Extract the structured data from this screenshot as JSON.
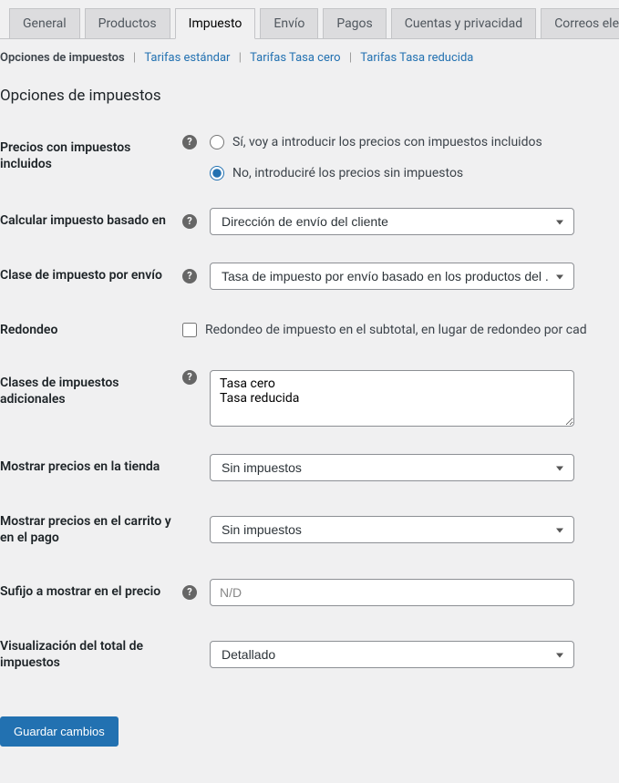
{
  "tabs": [
    {
      "label": "General",
      "active": false
    },
    {
      "label": "Productos",
      "active": false
    },
    {
      "label": "Impuesto",
      "active": true
    },
    {
      "label": "Envío",
      "active": false
    },
    {
      "label": "Pagos",
      "active": false
    },
    {
      "label": "Cuentas y privacidad",
      "active": false
    },
    {
      "label": "Correos electróni",
      "active": false
    }
  ],
  "subnav": {
    "items": [
      {
        "label": "Opciones de impuestos",
        "current": true
      },
      {
        "label": "Tarifas estándar",
        "current": false
      },
      {
        "label": "Tarifas Tasa cero",
        "current": false
      },
      {
        "label": "Tarifas Tasa reducida",
        "current": false
      }
    ]
  },
  "section_title": "Opciones de impuestos",
  "fields": {
    "prices_with_tax": {
      "label": "Precios con impuestos incluidos",
      "option_yes": "Sí, voy a introducir los precios con impuestos incluidos",
      "option_no": "No, introduciré los precios sin impuestos",
      "selected": "no"
    },
    "calc_based_on": {
      "label": "Calcular impuesto basado en",
      "value": "Dirección de envío del cliente"
    },
    "shipping_tax_class": {
      "label": "Clase de impuesto por envío",
      "value": "Tasa de impuesto por envío basado en los productos del ..."
    },
    "rounding": {
      "label": "Redondeo",
      "option": "Redondeo de impuesto en el subtotal, en lugar de redondeo por cad",
      "checked": false
    },
    "additional_classes": {
      "label": "Clases de impuestos adicionales",
      "value": "Tasa cero\nTasa reducida"
    },
    "display_shop": {
      "label": "Mostrar precios en la tienda",
      "value": "Sin impuestos"
    },
    "display_cart": {
      "label": "Mostrar precios en el carrito y en el pago",
      "value": "Sin impuestos"
    },
    "price_suffix": {
      "label": "Sufijo a mostrar en el precio",
      "placeholder": "N/D",
      "value": ""
    },
    "tax_total_display": {
      "label": "Visualización del total de impuestos",
      "value": "Detallado"
    }
  },
  "submit_label": "Guardar cambios"
}
